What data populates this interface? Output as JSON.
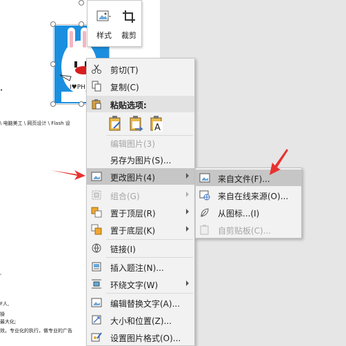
{
  "document": {
    "snippets": [
      "\\ 电脑美工 \\ 网页设计 \\ Flash 设",
      "F人,",
      "操",
      "最大化;",
      "效。专业化的执行，做专业的广告"
    ],
    "picture_text": "I♥PH"
  },
  "float_bar": {
    "style_label": "样式",
    "crop_label": "裁剪"
  },
  "context_menu": {
    "items": [
      {
        "label": "剪切(T)",
        "icon": "scissors-icon",
        "enabled": true
      },
      {
        "label": "复制(C)",
        "icon": "copy-icon",
        "enabled": true
      },
      {
        "label": "粘贴选项:",
        "icon": "paste-icon",
        "enabled": true
      },
      {
        "label": "编辑图片(3)",
        "enabled": false
      },
      {
        "label": "另存为图片(S)...",
        "enabled": true
      },
      {
        "label": "更改图片(4)",
        "icon": "change-picture-icon",
        "enabled": true,
        "submenu": true,
        "highlighted": true
      },
      {
        "label": "组合(G)",
        "icon": "group-icon",
        "enabled": false,
        "submenu": true
      },
      {
        "label": "置于顶层(R)",
        "icon": "bring-front-icon",
        "enabled": true,
        "submenu": true
      },
      {
        "label": "置于底层(K)",
        "icon": "send-back-icon",
        "enabled": true,
        "submenu": true
      },
      {
        "label": "链接(I)",
        "icon": "link-icon",
        "enabled": true
      },
      {
        "label": "插入题注(N)...",
        "icon": "caption-icon",
        "enabled": true
      },
      {
        "label": "环绕文字(W)",
        "icon": "wrap-text-icon",
        "enabled": true,
        "submenu": true
      },
      {
        "label": "编辑替换文字(A)...",
        "icon": "alt-text-icon",
        "enabled": true
      },
      {
        "label": "大小和位置(Z)...",
        "icon": "size-position-icon",
        "enabled": true
      },
      {
        "label": "设置图片格式(O)...",
        "icon": "format-picture-icon",
        "enabled": true
      }
    ]
  },
  "submenu": {
    "items": [
      {
        "label": "来自文件(F)...",
        "icon": "from-file-icon",
        "enabled": true,
        "highlighted": true
      },
      {
        "label": "来自在线来源(O)...",
        "icon": "online-source-icon",
        "enabled": true
      },
      {
        "label": "从图标...(I)",
        "icon": "from-icons-icon",
        "enabled": true
      },
      {
        "label": "自剪贴板(C)...",
        "icon": "from-clipboard-icon",
        "enabled": false
      }
    ]
  },
  "colors": {
    "highlight": "#c6c6c6",
    "menu_bg": "#f2f2f2",
    "annotation_arrow": "#e8322f",
    "picture_bg": "#1a8fe0"
  }
}
